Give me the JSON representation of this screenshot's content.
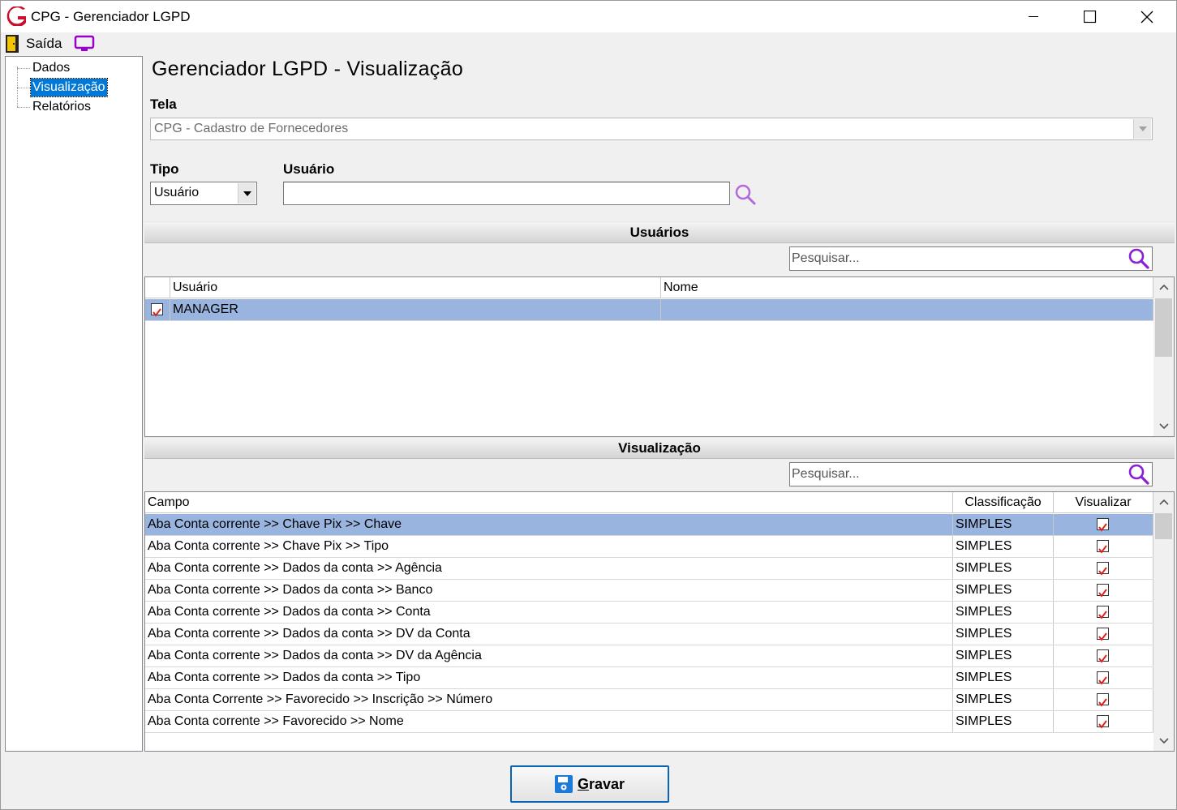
{
  "window": {
    "title": "CPG - Gerenciador LGPD"
  },
  "menu": {
    "exit_label": "Saída"
  },
  "tree": {
    "items": [
      {
        "label": "Dados"
      },
      {
        "label": "Visualização",
        "selected": true
      },
      {
        "label": "Relatórios"
      }
    ]
  },
  "page": {
    "title": "Gerenciador LGPD - Visualização"
  },
  "form": {
    "tela_label": "Tela",
    "tela_value": "CPG - Cadastro de Fornecedores",
    "tipo_label": "Tipo",
    "tipo_value": "Usuário",
    "usuario_label": "Usuário",
    "usuario_value": ""
  },
  "users_section": {
    "title": "Usuários",
    "search_placeholder": "Pesquisar...",
    "columns": [
      "Usuário",
      "Nome"
    ],
    "rows": [
      {
        "checked": true,
        "usuario": "MANAGER",
        "nome": ""
      }
    ]
  },
  "view_section": {
    "title": "Visualização",
    "search_placeholder": "Pesquisar...",
    "columns": [
      "Campo",
      "Classificação",
      "Visualizar"
    ],
    "rows": [
      {
        "campo": "Aba Conta corrente >> Chave Pix >> Chave",
        "classificacao": "SIMPLES",
        "visualizar": true
      },
      {
        "campo": "Aba Conta corrente >> Chave Pix >> Tipo",
        "classificacao": "SIMPLES",
        "visualizar": true
      },
      {
        "campo": "Aba Conta corrente >> Dados da conta >> Agência",
        "classificacao": "SIMPLES",
        "visualizar": true
      },
      {
        "campo": "Aba Conta corrente >> Dados da conta >> Banco",
        "classificacao": "SIMPLES",
        "visualizar": true
      },
      {
        "campo": "Aba Conta corrente >> Dados da conta >> Conta",
        "classificacao": "SIMPLES",
        "visualizar": true
      },
      {
        "campo": "Aba Conta corrente >> Dados da conta >> DV da  Conta",
        "classificacao": "SIMPLES",
        "visualizar": true
      },
      {
        "campo": "Aba Conta corrente >> Dados da conta >> DV da Agência",
        "classificacao": "SIMPLES",
        "visualizar": true
      },
      {
        "campo": "Aba Conta corrente >> Dados da conta >> Tipo",
        "classificacao": "SIMPLES",
        "visualizar": true
      },
      {
        "campo": "Aba Conta Corrente >> Favorecido >> Inscrição >> Número",
        "classificacao": "SIMPLES",
        "visualizar": true
      },
      {
        "campo": "Aba Conta corrente >> Favorecido >> Nome",
        "classificacao": "SIMPLES",
        "visualizar": true
      }
    ]
  },
  "actions": {
    "save_label": "Gravar"
  },
  "colors": {
    "accent": "#0078d7",
    "selected_row": "#99b4de",
    "check_red": "#e0201b",
    "search_icon": "#8a2be2"
  }
}
